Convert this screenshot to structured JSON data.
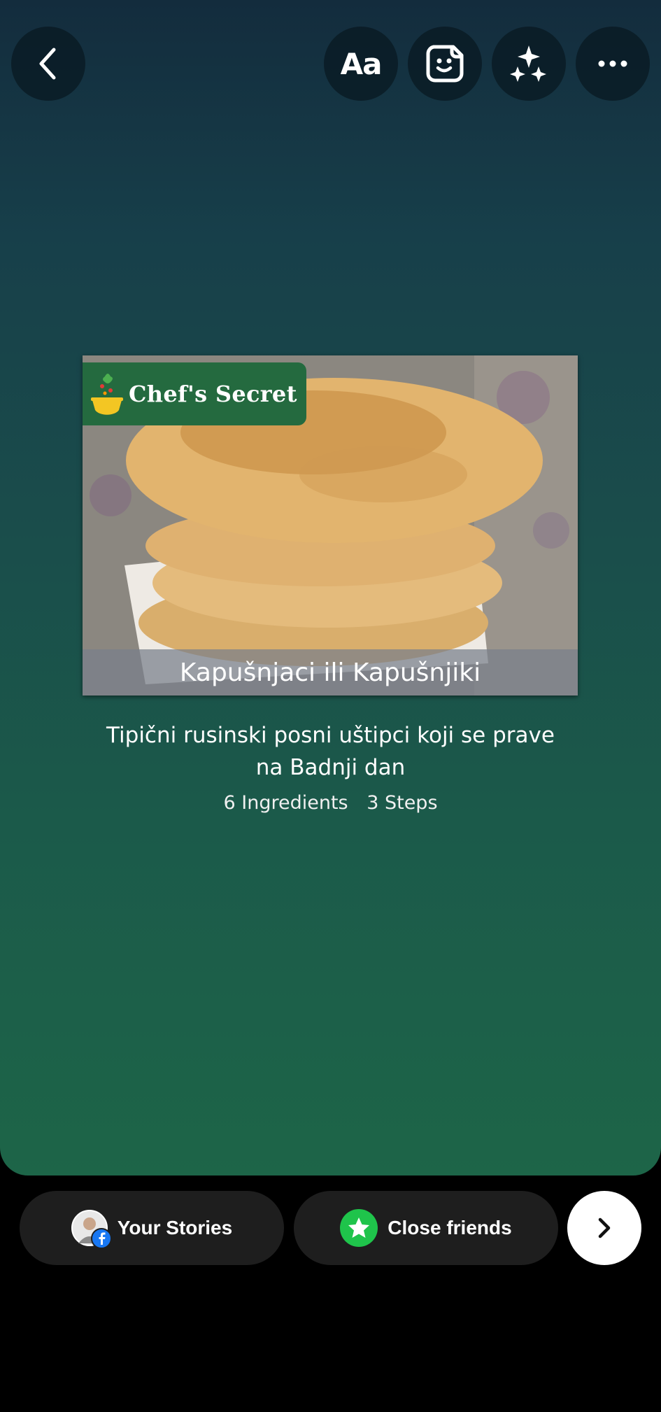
{
  "toolbar": {
    "back_icon": "chevron-left-icon",
    "text_tool_label": "Aa",
    "sticker_icon": "sticker-icon",
    "effects_icon": "sparkles-icon",
    "more_icon": "more-horizontal-icon"
  },
  "recipe_card": {
    "brand": "Chef's Secret",
    "title": "Kapušnjaci ili Kapušnjiki",
    "description": "Tipični rusinski posni uštipci koji se prave na Badnji dan",
    "ingredients": "6 Ingredients",
    "steps": "3 Steps"
  },
  "share_bar": {
    "your_stories_label": "Your Stories",
    "close_friends_label": "Close friends",
    "next_icon": "chevron-right-icon"
  },
  "colors": {
    "gradient_top": "#132c3d",
    "gradient_bottom": "#1d6548",
    "brand_badge": "#246a3f",
    "close_friends_star": "#1fc44b",
    "facebook_blue": "#1877f2",
    "pill_background": "#1e1e1e"
  }
}
